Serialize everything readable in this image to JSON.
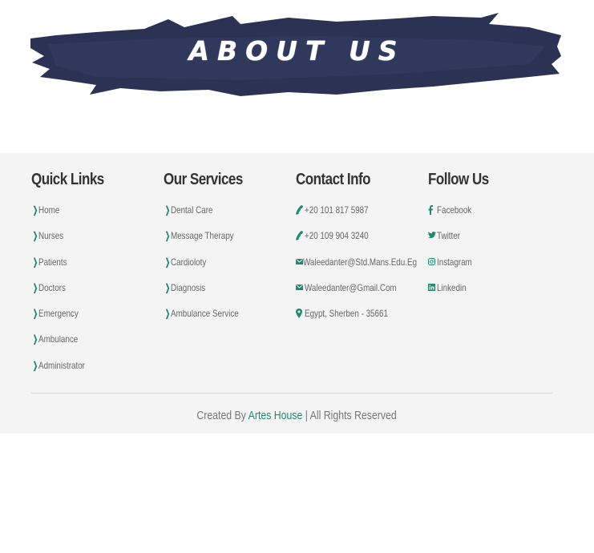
{
  "banner": {
    "title": "ABOUT US",
    "color": "#2a3152"
  },
  "footer": {
    "background": "#f4f4f4",
    "accent": "#1f8a70",
    "quick_links": {
      "heading": "Quick Links",
      "items": [
        "Home",
        "Nurses",
        "Patients",
        "Doctors",
        "Emergency",
        "Ambulance",
        "Administrator"
      ]
    },
    "services": {
      "heading": "Our Services",
      "items": [
        "Dental Care",
        "Message Therapy",
        "Cardioloty",
        "Diagnosis",
        "Ambulance Service"
      ]
    },
    "contact": {
      "heading": "Contact Info",
      "items": [
        {
          "icon": "phone-icon",
          "text": "+20 101 817 5987"
        },
        {
          "icon": "phone-icon",
          "text": "+20 109 904 3240"
        },
        {
          "icon": "envelope-icon",
          "text": "Waleedanter@Std.Mans.Edu.Eg"
        },
        {
          "icon": "envelope-icon",
          "text": "Waleedanter@Gmail.Com"
        },
        {
          "icon": "map-marker-icon",
          "text": "Egypt, Sherben - 35661"
        }
      ]
    },
    "follow": {
      "heading": "Follow Us",
      "items": [
        {
          "icon": "facebook-icon",
          "text": "Facebook"
        },
        {
          "icon": "twitter-icon",
          "text": "Twitter"
        },
        {
          "icon": "instagram-icon",
          "text": "Instagram"
        },
        {
          "icon": "linkedin-icon",
          "text": "Linkedin"
        }
      ]
    },
    "copyright": {
      "prefix": "Created By ",
      "brand": "Artes House",
      "suffix": " | All Rights Reserved"
    }
  }
}
